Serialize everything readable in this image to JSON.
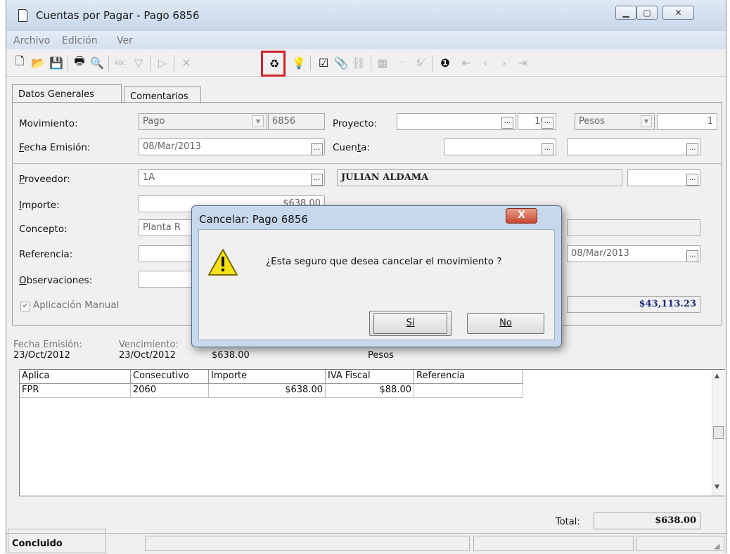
{
  "window": {
    "title": "Cuentas por Pagar - Pago 6856"
  },
  "menu": [
    "Archivo",
    "Edición",
    "Ver"
  ],
  "tabs": [
    "Datos Generales",
    "Comentarios"
  ],
  "form": {
    "movimiento_label": "Movimiento:",
    "movimiento_value": "Pago",
    "movimiento_number": "6856",
    "proyecto_label": "Proyecto:",
    "proyecto_value": "",
    "proyecto_num": "105",
    "moneda": "Pesos",
    "tipo_cambio": "1",
    "fecha_emision_label": "Fecha Emisión:",
    "fecha_emision_value": "08/Mar/2013",
    "cuenta_label": "Cuenta:",
    "proveedor_label": "Proveedor:",
    "proveedor_code": "1A",
    "proveedor_name": "JULIAN ALDAMA",
    "importe_label": "Importe:",
    "importe_value": "$638.00",
    "concepto_label": "Concepto:",
    "concepto_value": "Planta R",
    "referencia_label": "Referencia:",
    "observaciones_label": "Observaciones:",
    "fecha_right": "08/Mar/2013",
    "aplicacion_manual": "Aplicación Manual",
    "saldo": "$43,113.23"
  },
  "summary": {
    "fecha_emision_label": "Fecha Emisión:",
    "fecha_emision_value": "23/Oct/2012",
    "vencimiento_label": "Vencimiento:",
    "vencimiento_value": "23/Oct/2012",
    "importe_value": "$638.00",
    "moneda": "Pesos"
  },
  "table": {
    "headers": [
      "Aplica",
      "Consecutivo",
      "Importe",
      "IVA Fiscal",
      "Referencia"
    ],
    "rows": [
      [
        "FPR",
        "2060",
        "$638.00",
        "$88.00",
        ""
      ]
    ]
  },
  "total": {
    "label": "Total:",
    "value": "$638.00"
  },
  "status": {
    "text": "Concluido"
  },
  "dialog": {
    "title": "Cancelar: Pago 6856",
    "close": "X",
    "message": "¿Esta seguro que desea cancelar el movimiento ?",
    "yes": "Sí",
    "no": "No"
  },
  "colors": {
    "highlight": "#d0232f",
    "title_bar": "#c7d7ea",
    "dialog_frame": "#c7d8ec"
  }
}
